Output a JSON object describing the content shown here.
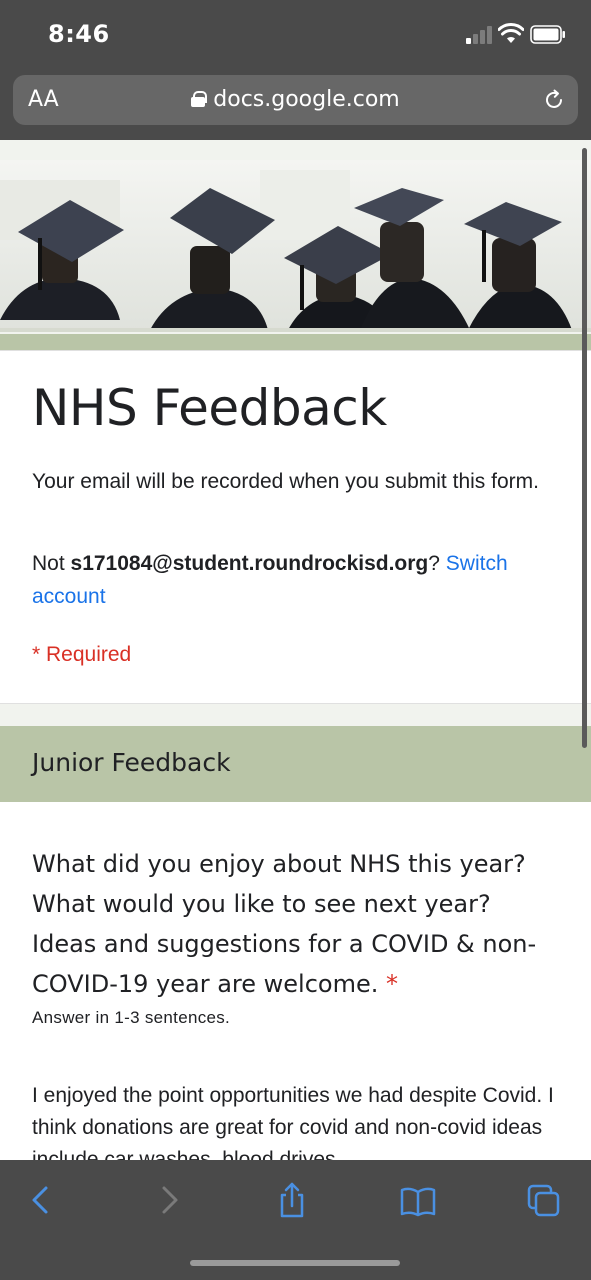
{
  "status_bar": {
    "time": "8:46"
  },
  "browser": {
    "text_size_label": "AA",
    "url": "docs.google.com",
    "icons": [
      "lock-icon",
      "reload-icon"
    ]
  },
  "form": {
    "title": "NHS Feedback",
    "email_notice": "Your email will be recorded when you submit this form.",
    "account_prefix": "Not ",
    "account_email": "s171084@student.roundrockisd.org",
    "account_suffix": "? ",
    "switch_account": "Switch account",
    "required_note": "* Required"
  },
  "section": {
    "title": "Junior Feedback"
  },
  "question": {
    "text": "What did you enjoy about NHS this year? What would you like to see next year? Ideas and suggestions for a COVID & non-COVID-19 year are welcome.",
    "required_marker": "*",
    "help_text": "Answer in 1-3 sentences.",
    "answer": "I enjoyed the point opportunities we had despite Covid. I think donations are great for covid and non-covid ideas include car washes, blood drives"
  },
  "toolbar": {
    "icons": [
      "back-icon",
      "forward-icon",
      "share-icon",
      "bookmarks-icon",
      "tabs-icon"
    ]
  },
  "colors": {
    "accent": "#b9c5a7",
    "link": "#1a73e8",
    "required": "#d93025",
    "chrome": "#4a4a4a"
  }
}
